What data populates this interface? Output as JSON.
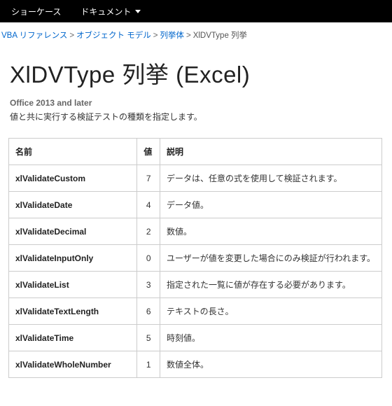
{
  "nav": {
    "items": [
      {
        "label": "ショーケース",
        "has_dropdown": false
      },
      {
        "label": "ドキュメント",
        "has_dropdown": true
      }
    ]
  },
  "breadcrumb": {
    "links": [
      {
        "label": "VBA リファレンス"
      },
      {
        "label": "オブジェクト モデル"
      },
      {
        "label": "列挙体"
      }
    ],
    "current": "XlDVType 列挙"
  },
  "page": {
    "title": "XlDVType 列挙 (Excel)",
    "subhead": "Office 2013 and later",
    "description": "値と共に実行する検証テストの種類を指定します。"
  },
  "table": {
    "headers": {
      "name": "名前",
      "value": "値",
      "desc": "説明"
    },
    "rows": [
      {
        "name": "xlValidateCustom",
        "value": 7,
        "desc": "データは、任意の式を使用して検証されます。"
      },
      {
        "name": "xlValidateDate",
        "value": 4,
        "desc": "データ値。"
      },
      {
        "name": "xlValidateDecimal",
        "value": 2,
        "desc": "数値。"
      },
      {
        "name": "xlValidateInputOnly",
        "value": 0,
        "desc": "ユーザーが値を変更した場合にのみ検証が行われます。"
      },
      {
        "name": "xlValidateList",
        "value": 3,
        "desc": "指定された一覧に値が存在する必要があります。"
      },
      {
        "name": "xlValidateTextLength",
        "value": 6,
        "desc": "テキストの長さ。"
      },
      {
        "name": "xlValidateTime",
        "value": 5,
        "desc": "時刻値。"
      },
      {
        "name": "xlValidateWholeNumber",
        "value": 1,
        "desc": "数値全体。"
      }
    ]
  }
}
